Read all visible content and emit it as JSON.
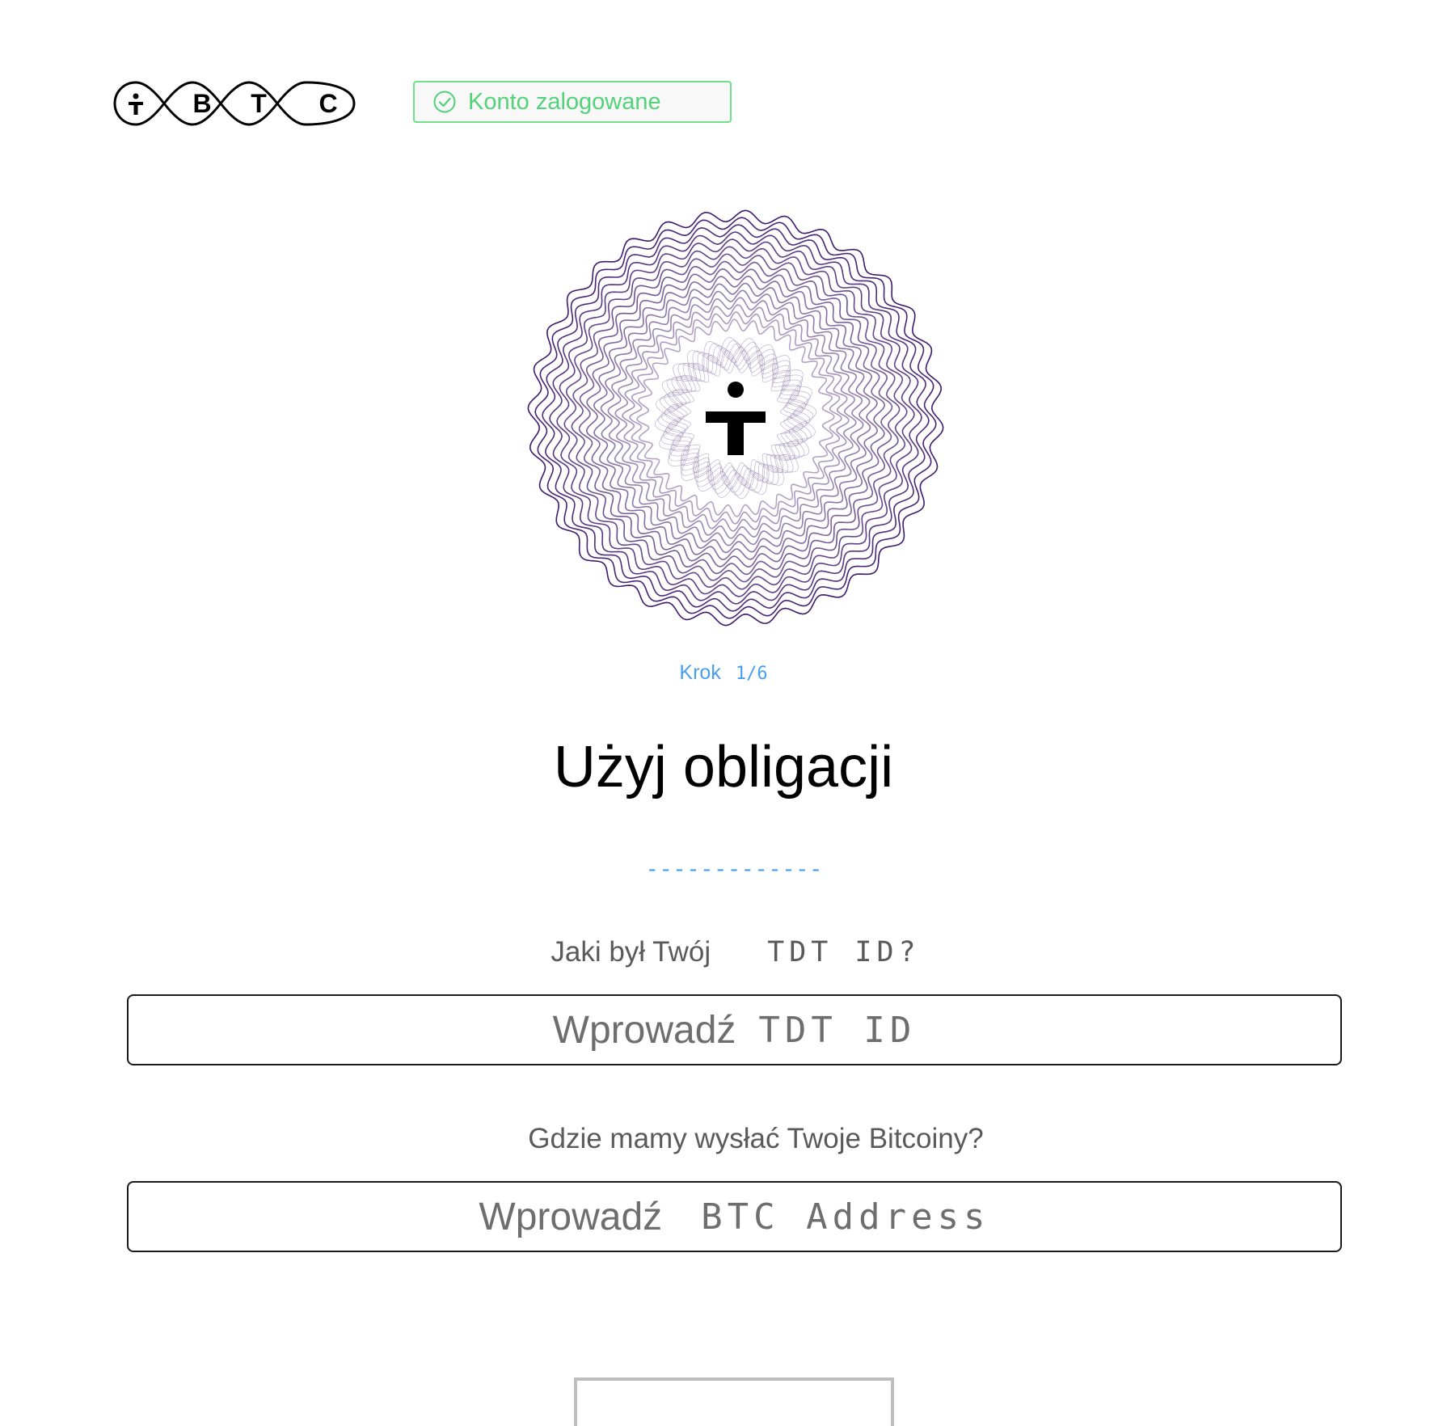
{
  "header": {
    "logo_letters": [
      "B",
      "T",
      "C"
    ],
    "status": "Konto zalogowane"
  },
  "hero": {
    "icon": "tbtc-mark-spirograph-icon"
  },
  "step": {
    "label": "Krok",
    "value": "1/6"
  },
  "title": "Użyj obligacji",
  "divider": "-------------",
  "form": {
    "tdt": {
      "label_text": "Jaki był Twój",
      "label_mono": "TDT ID?",
      "placeholder_a": "Wprowadź",
      "placeholder_b": "TDT ID"
    },
    "btc": {
      "label": "Gdzie mamy wysłać Twoje Bitcoiny?",
      "placeholder_a": "Wprowadź",
      "placeholder_b": "BTC Address"
    }
  },
  "colors": {
    "accent": "#4a9ef0",
    "success": "#52d279",
    "spiro": "#3e1a6e"
  }
}
